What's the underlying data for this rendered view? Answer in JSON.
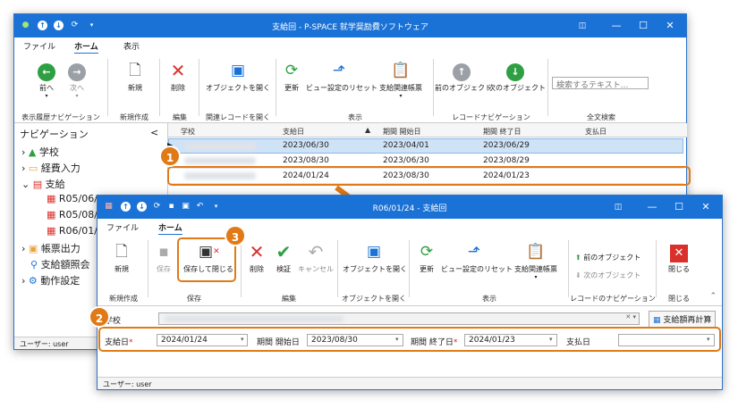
{
  "colors": {
    "titlebar": "#1b72d6",
    "highlight": "#e07a16",
    "green": "#2ea043",
    "red": "#d9302c",
    "gray": "#9aa0a6"
  },
  "back": {
    "title": "支給回 - P-SPACE 就学奨励費ソフトウェア",
    "tabs": [
      "ファイル",
      "ホーム",
      "表示"
    ],
    "ribbon": {
      "back": "前へ",
      "forward": "次へ",
      "new": "新規",
      "delete": "削除",
      "open_obj": "オブジェクトを開く",
      "refresh": "更新",
      "reset_view": "ビュー設定のリセット",
      "related_report": "支給関連帳票",
      "prev_obj": "前のオブジェクト",
      "next_obj": "次のオブジェクト",
      "search_placeholder": "検索するテキスト..."
    },
    "groups": [
      "表示履歴ナビゲーション",
      "新規作成",
      "編集",
      "関連レコードを開く",
      "表示",
      "レコードナビゲーション",
      "全文検索"
    ],
    "nav": {
      "title": "ナビゲーション",
      "collapse": "<",
      "items": [
        "学校",
        "経費入力",
        "支給",
        "R05/06/",
        "R05/08/",
        "R06/01/",
        "帳票出力",
        "支給額照会",
        "動作設定"
      ]
    },
    "grid": {
      "headers": [
        "学校",
        "支給日",
        "期間 開始日",
        "期間 終了日",
        "支払日"
      ],
      "rows": [
        [
          "",
          "2023/06/30",
          "2023/04/01",
          "2023/06/29",
          ""
        ],
        [
          "",
          "2023/08/30",
          "2023/06/30",
          "2023/08/29",
          ""
        ],
        [
          "",
          "2024/01/24",
          "2023/08/30",
          "2024/01/23",
          ""
        ]
      ]
    },
    "status": "ユーザー: user"
  },
  "front": {
    "title": "R06/01/24 - 支給回",
    "tabs": [
      "ファイル",
      "ホーム"
    ],
    "ribbon": {
      "new": "新規",
      "save": "保存",
      "save_close": "保存して閉じる",
      "delete": "削除",
      "verify": "検証",
      "cancel": "キャンセル",
      "open_obj": "オブジェクトを開く",
      "refresh": "更新",
      "reset_view": "ビュー設定のリセット",
      "related_report": "支給関連帳票",
      "prev_obj": "前のオブジェクト",
      "next_obj": "次のオブジェクト",
      "close": "閉じる"
    },
    "groups": [
      "新規作成",
      "保存",
      "編集",
      "オブジェクトを開く",
      "表示",
      "レコードのナビゲーション",
      "閉じる"
    ],
    "form": {
      "school_label": "学校",
      "recalc": "支給額再計算",
      "pay_date_label": "支給日",
      "pay_date": "2024/01/24",
      "start_label": "期間 開始日",
      "start": "2023/08/30",
      "end_label": "期間 終了日",
      "end": "2024/01/23",
      "paid_label": "支払日",
      "paid": ""
    },
    "status": "ユーザー: user"
  },
  "badges": [
    "1",
    "2",
    "3"
  ]
}
